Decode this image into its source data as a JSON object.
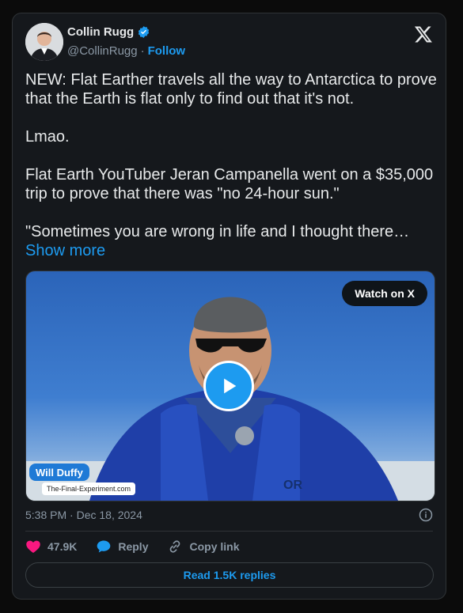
{
  "author": {
    "name": "Collin Rugg",
    "handle": "@CollinRugg",
    "follow_label": "Follow"
  },
  "post": {
    "text": "NEW: Flat Earther travels all the way to Antarctica to prove that the Earth is flat only to find out that it's not.\n\nLmao.\n\nFlat Earth YouTuber Jeran Campanella went on a $35,000 trip to prove that there was \"no 24-hour sun.\"\n\n\"Sometimes you are wrong in life and I thought there…",
    "show_more": "Show more"
  },
  "media": {
    "watch_label": "Watch on X",
    "lower_third_name": "Will Duffy",
    "lower_third_site": "The-Final-Experiment.com"
  },
  "meta": {
    "timestamp": "5:38 PM · Dec 18, 2024"
  },
  "actions": {
    "likes": "47.9K",
    "reply_label": "Reply",
    "copy_label": "Copy link"
  },
  "read_replies_label": "Read 1.5K replies",
  "colors": {
    "accent": "#1d9bf0",
    "like": "#f91880"
  },
  "icons": [
    "verified-badge-icon",
    "x-logo-icon",
    "play-icon",
    "info-icon",
    "heart-icon",
    "reply-icon",
    "link-icon"
  ]
}
